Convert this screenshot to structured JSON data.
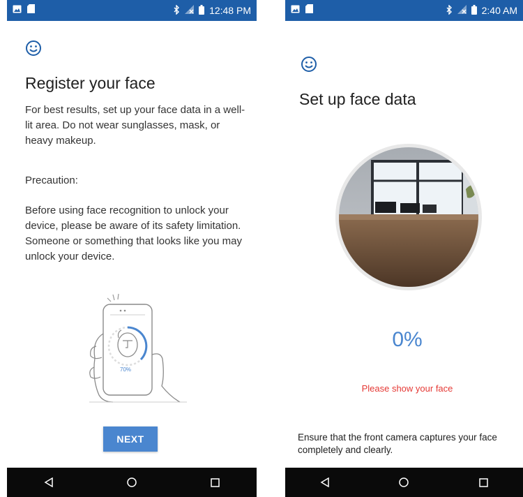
{
  "left": {
    "status": {
      "time": "12:48 PM"
    },
    "title": "Register your face",
    "intro": "For best results, set up your face data in a well-lit area. Do not wear sunglasses, mask, or heavy makeup.",
    "precaution_heading": "Precaution:",
    "precaution_body": "Before using face recognition to unlock your device, please be aware of its safety limitation. Someone or something that looks like you may unlock your device.",
    "illustration_percent": "70%",
    "next_label": "NEXT"
  },
  "right": {
    "status": {
      "time": "2:40 AM"
    },
    "title": "Set up face data",
    "progress": "0%",
    "warning": "Please show your face",
    "hint": "Ensure that the front camera captures your face completely and clearly."
  },
  "icons": {
    "status_left": [
      "image-icon",
      "sd-card-icon"
    ],
    "status_right": [
      "bluetooth-icon",
      "no-signal-icon",
      "battery-icon"
    ],
    "nav": [
      "back-icon",
      "home-icon",
      "recents-icon"
    ],
    "header": "smiley-face-icon"
  },
  "colors": {
    "status_bar": "#1e5ea8",
    "accent": "#4a86cf",
    "warning": "#e53935",
    "nav_bar": "#0a0a0a"
  }
}
